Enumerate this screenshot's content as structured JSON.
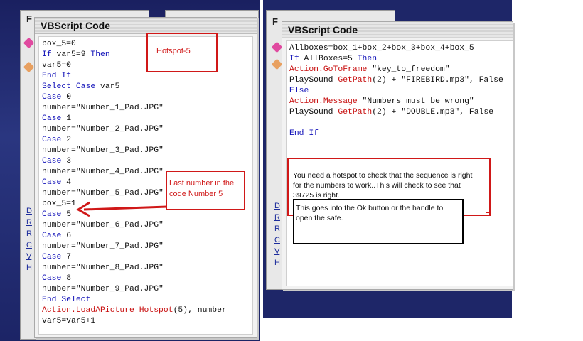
{
  "left_window": {
    "title": "VBScript Code",
    "lines": [
      [
        {
          "t": "box_5=0",
          "c": "tx"
        }
      ],
      [
        {
          "t": "If ",
          "c": "kw"
        },
        {
          "t": "var5=9 ",
          "c": "tx"
        },
        {
          "t": "Then",
          "c": "kw"
        }
      ],
      [
        {
          "t": "var5=0",
          "c": "tx"
        }
      ],
      [
        {
          "t": "End If",
          "c": "kw"
        }
      ],
      [
        {
          "t": "Select Case ",
          "c": "kw"
        },
        {
          "t": "var5",
          "c": "tx"
        }
      ],
      [
        {
          "t": "Case ",
          "c": "kw"
        },
        {
          "t": "0",
          "c": "tx"
        }
      ],
      [
        {
          "t": "number=\"Number_1_Pad.JPG\"",
          "c": "tx"
        }
      ],
      [
        {
          "t": "Case ",
          "c": "kw"
        },
        {
          "t": "1",
          "c": "tx"
        }
      ],
      [
        {
          "t": "number=\"Number_2_Pad.JPG\"",
          "c": "tx"
        }
      ],
      [
        {
          "t": "Case ",
          "c": "kw"
        },
        {
          "t": "2",
          "c": "tx"
        }
      ],
      [
        {
          "t": "number=\"Number_3_Pad.JPG\"",
          "c": "tx"
        }
      ],
      [
        {
          "t": "Case ",
          "c": "kw"
        },
        {
          "t": "3",
          "c": "tx"
        }
      ],
      [
        {
          "t": "number=\"Number_4_Pad.JPG\"",
          "c": "tx"
        }
      ],
      [
        {
          "t": "Case ",
          "c": "kw"
        },
        {
          "t": "4",
          "c": "tx"
        }
      ],
      [
        {
          "t": "number=\"Number_5_Pad.JPG\"",
          "c": "tx"
        }
      ],
      [
        {
          "t": "box_5=1",
          "c": "tx"
        }
      ],
      [
        {
          "t": "Case ",
          "c": "kw"
        },
        {
          "t": "5",
          "c": "tx"
        }
      ],
      [
        {
          "t": "number=\"Number_6_Pad.JPG\"",
          "c": "tx"
        }
      ],
      [
        {
          "t": "Case ",
          "c": "kw"
        },
        {
          "t": "6",
          "c": "tx"
        }
      ],
      [
        {
          "t": "number=\"Number_7_Pad.JPG\"",
          "c": "tx"
        }
      ],
      [
        {
          "t": "Case ",
          "c": "kw"
        },
        {
          "t": "7",
          "c": "tx"
        }
      ],
      [
        {
          "t": "number=\"Number_8_Pad.JPG\"",
          "c": "tx"
        }
      ],
      [
        {
          "t": "Case ",
          "c": "kw"
        },
        {
          "t": "8",
          "c": "tx"
        }
      ],
      [
        {
          "t": "number=\"Number_9_Pad.JPG\"",
          "c": "tx"
        }
      ],
      [
        {
          "t": "End Select",
          "c": "kw"
        }
      ],
      [
        {
          "t": "Action.LoadAPicture ",
          "c": "fn"
        },
        {
          "t": "Hotspot",
          "c": "fn"
        },
        {
          "t": "(5), number",
          "c": "tx"
        }
      ],
      [
        {
          "t": "var5=var5+1",
          "c": "tx"
        }
      ]
    ],
    "annotation_hotspot": "Hotspot-5",
    "annotation_last": "Last number in the code Number 5",
    "back_title_letter": "F",
    "side_links": [
      "D",
      "R",
      "R",
      "C",
      "V",
      "H"
    ]
  },
  "right_window": {
    "title": "VBScript Code",
    "lines": [
      [
        {
          "t": "Allboxes=box_1+box_2+box_3+box_4+box_5",
          "c": "tx"
        }
      ],
      [
        {
          "t": "If ",
          "c": "kw"
        },
        {
          "t": "AllBoxes=5 ",
          "c": "tx"
        },
        {
          "t": "Then",
          "c": "kw"
        }
      ],
      [
        {
          "t": "Action.GoToFrame ",
          "c": "fn"
        },
        {
          "t": "\"key_to_freedom\"",
          "c": "tx"
        }
      ],
      [
        {
          "t": "PlaySound ",
          "c": "tx"
        },
        {
          "t": "GetPath",
          "c": "fn"
        },
        {
          "t": "(2) + \"FIREBIRD.mp3\", False",
          "c": "tx"
        }
      ],
      [
        {
          "t": "Else",
          "c": "kw"
        }
      ],
      [
        {
          "t": "Action.Message ",
          "c": "fn"
        },
        {
          "t": "\"Numbers must be wrong\"",
          "c": "tx"
        }
      ],
      [
        {
          "t": "PlaySound ",
          "c": "tx"
        },
        {
          "t": "GetPath",
          "c": "fn"
        },
        {
          "t": "(2) + \"DOUBLE.mp3\", False",
          "c": "tx"
        }
      ],
      [
        {
          "t": "",
          "c": "tx"
        }
      ],
      [
        {
          "t": "End If",
          "c": "kw"
        }
      ]
    ],
    "note_red": "You need a hotspot to check that the sequence is right for the numbers to work..This will check to see that 39725 is right.",
    "note_black": "This goes into the Ok button or the handle to open the safe.",
    "back_title_letter": "F",
    "side_links": [
      "D",
      "R",
      "R",
      "C",
      "V",
      "H"
    ]
  },
  "colors": {
    "keyword": "#1010b8",
    "function": "#c81010",
    "annotation_red": "#d01818"
  }
}
